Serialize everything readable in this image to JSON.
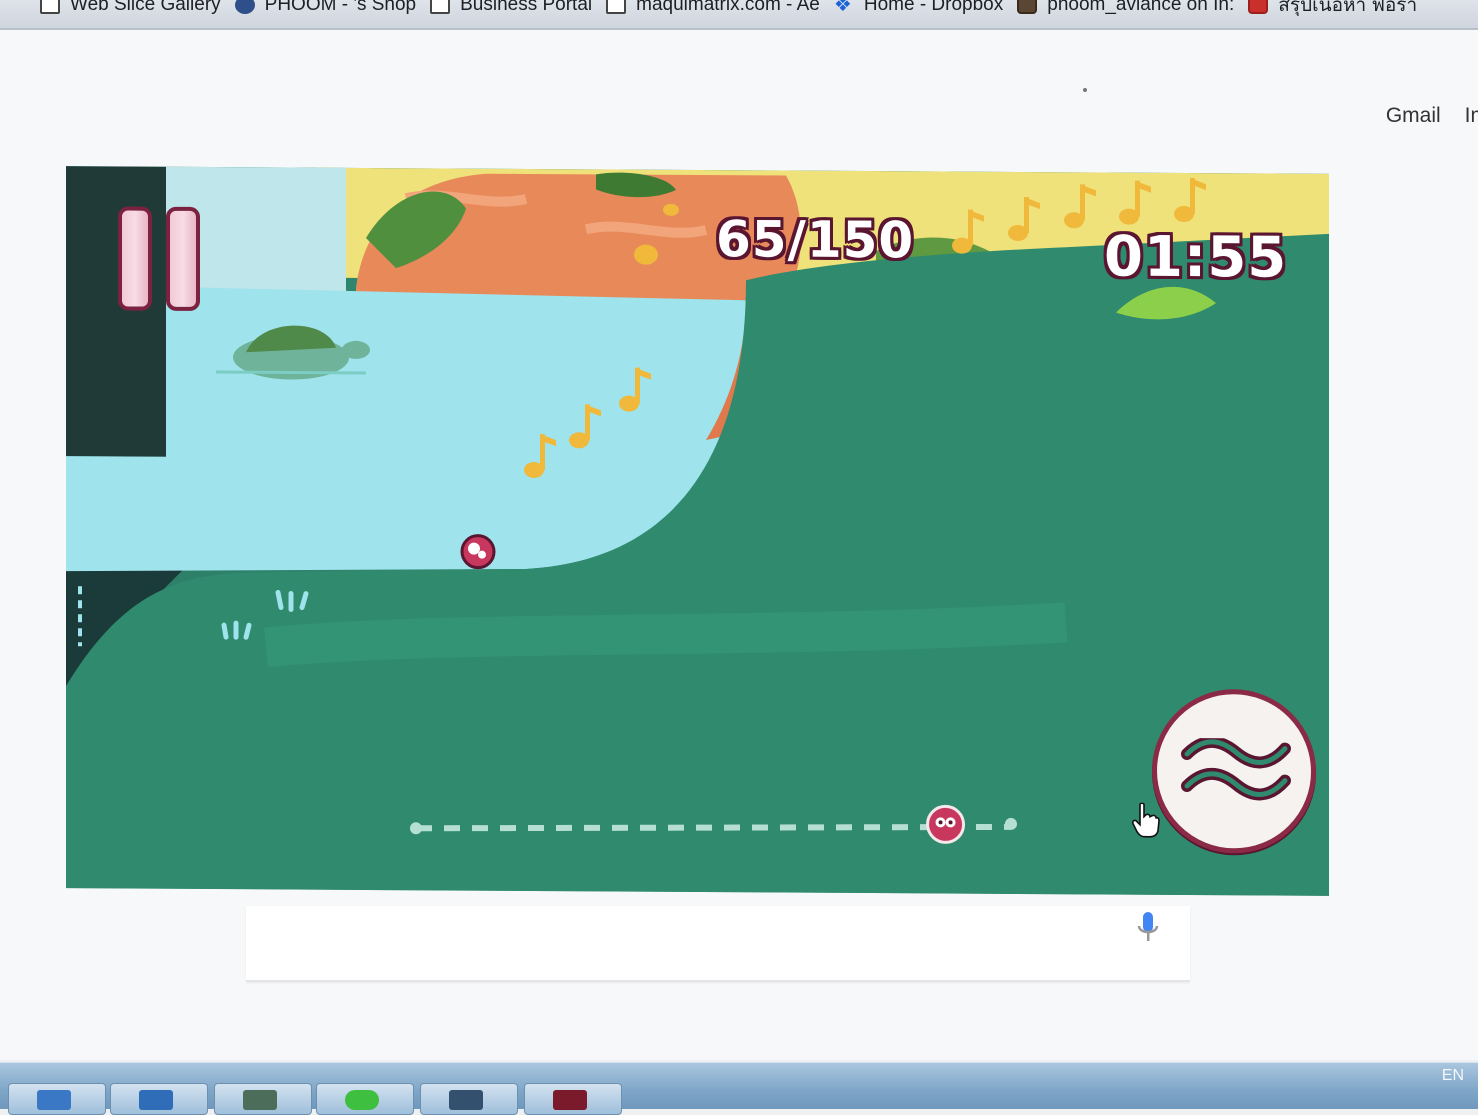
{
  "bookmarks": [
    {
      "label": "Web Slice Gallery",
      "icon": "page-icon"
    },
    {
      "label": "PHOOM - 's Shop",
      "icon": "globe-icon"
    },
    {
      "label": "Business Portal",
      "icon": "page-icon"
    },
    {
      "label": "maquimatrix.com - Ae",
      "icon": "page-icon"
    },
    {
      "label": "Home - Dropbox",
      "icon": "dropbox-icon"
    },
    {
      "label": "phoom_aviance on In:",
      "icon": "instagram-icon"
    },
    {
      "label": "สรุปเนื้อหา ฟอรา",
      "icon": "app-icon"
    }
  ],
  "header": {
    "gmail_label": "Gmail",
    "images_label": "Im"
  },
  "game": {
    "score": "65/150",
    "timer": "01:55",
    "progress_fraction": 0.89,
    "colors": {
      "water": "#9fe3ec",
      "grass": "#2f8a6e",
      "rock": "#e8895a",
      "sky": "#efe27a",
      "accent": "#8a2a46",
      "note": "#f0b93c"
    }
  },
  "taskbar": {
    "language": "EN",
    "buttons": [
      "explorer-icon",
      "folder-icon",
      "spreadsheet-icon",
      "line-app-icon",
      "network-icon",
      "acrobat-icon"
    ]
  }
}
